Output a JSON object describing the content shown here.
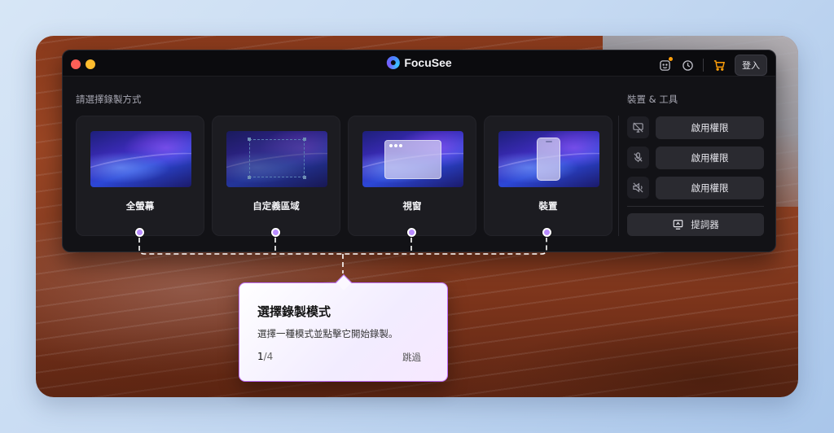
{
  "titlebar": {
    "app_name": "FocuSee",
    "login_label": "登入",
    "icons": [
      "feedback-icon",
      "history-icon",
      "cart-icon"
    ],
    "accent": "#ff9f0a"
  },
  "modes_section": {
    "title": "請選擇錄製方式",
    "items": [
      {
        "label": "全螢幕",
        "icon": "fullscreen-thumbnail"
      },
      {
        "label": "自定義區域",
        "icon": "custom-region-thumbnail"
      },
      {
        "label": "視窗",
        "icon": "window-thumbnail"
      },
      {
        "label": "裝置",
        "icon": "device-thumbnail"
      }
    ]
  },
  "devices_section": {
    "title": "裝置 & 工具",
    "permissions": [
      {
        "icon": "camera-off-icon",
        "label": "啟用權限"
      },
      {
        "icon": "mic-off-icon",
        "label": "啟用權限"
      },
      {
        "icon": "speaker-off-icon",
        "label": "啟用權限"
      }
    ],
    "prompter_label": "提詞器"
  },
  "tooltip": {
    "title": "選擇錄製模式",
    "description": "選擇一種模式並點擊它開始錄製。",
    "step_current": "1",
    "step_total": "/4",
    "skip_label": "跳過",
    "border_color": "#c070ff"
  }
}
